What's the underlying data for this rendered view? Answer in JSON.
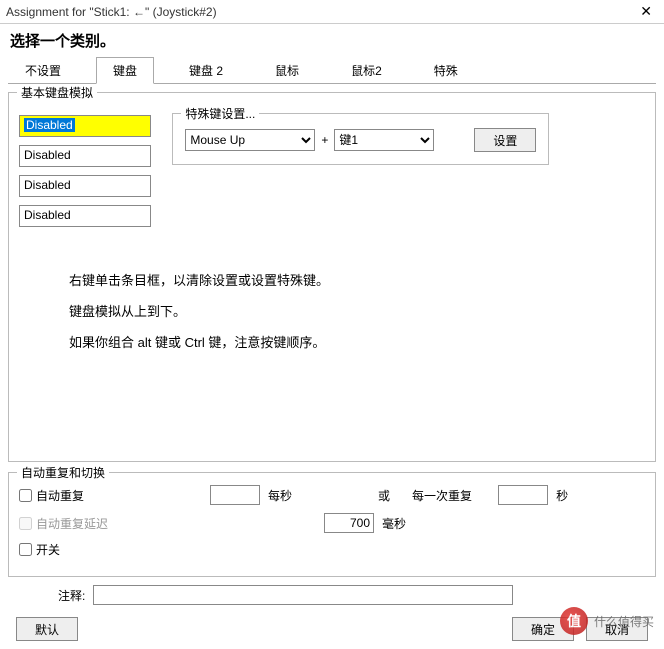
{
  "window": {
    "title": "Assignment for \"Stick1: ←\" (Joystick#2)"
  },
  "heading": "选择一个类别。",
  "tabs": {
    "items": [
      {
        "label": "不设置"
      },
      {
        "label": "键盘"
      },
      {
        "label": "键盘 2"
      },
      {
        "label": "鼠标"
      },
      {
        "label": "鼠标2"
      },
      {
        "label": "特殊"
      }
    ],
    "active_index": 1
  },
  "basic": {
    "title": "基本键盘模拟",
    "slots": [
      "Disabled",
      "Disabled",
      "Disabled",
      "Disabled"
    ],
    "special": {
      "title": "特殊键设置...",
      "combo1": "Mouse Up",
      "plus": "+",
      "combo2": "键1",
      "set_btn": "设置"
    }
  },
  "hints": {
    "line1": "右键单击条目框，以清除设置或设置特殊键。",
    "line2": "键盘模拟从上到下。",
    "line3": "如果你组合 alt 键或 Ctrl 键，注意按键顺序。"
  },
  "repeat": {
    "title": "自动重复和切换",
    "auto_repeat": "自动重复",
    "per_second": "每秒",
    "or": "或",
    "per_repeat": "每一次重复",
    "seconds": "秒",
    "auto_repeat_delay": "自动重复延迟",
    "delay_value": "700",
    "ms": "毫秒",
    "switch": "开关"
  },
  "comment": {
    "label": "注释:"
  },
  "buttons": {
    "default": "默认",
    "ok": "确定",
    "cancel": "取消"
  },
  "watermark": {
    "logo": "值",
    "text": "什么值得买"
  }
}
